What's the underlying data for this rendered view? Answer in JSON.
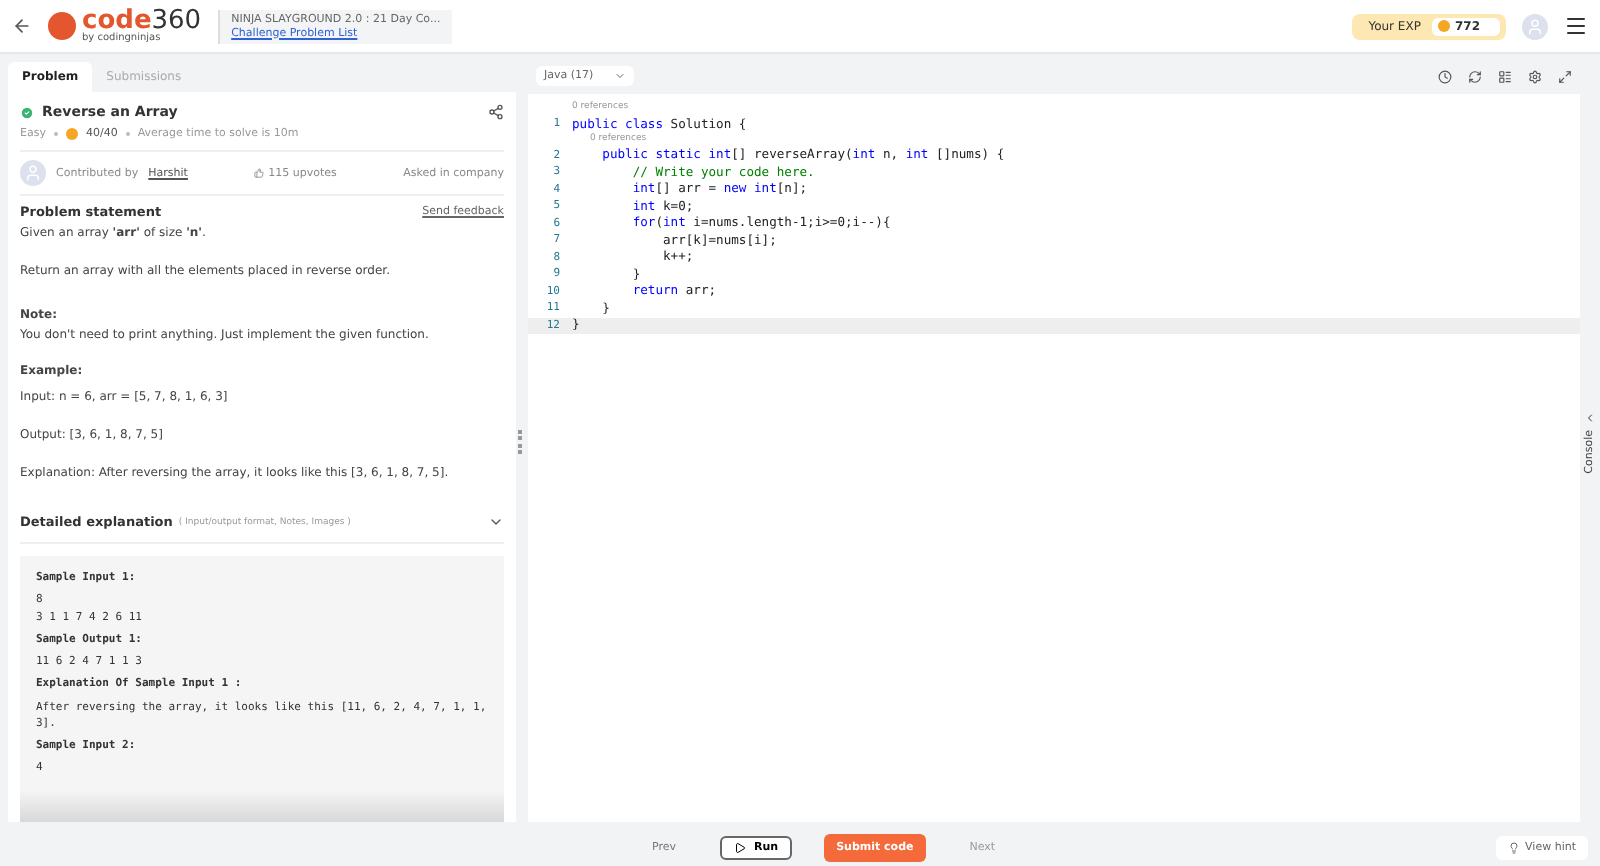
{
  "header": {
    "brand": "code",
    "brand_number": "360",
    "brand_sub": "by codingninjas",
    "contest": "NINJA SLAYGROUND 2.0 : 21 Day Co...",
    "contest_link": "Challenge Problem List",
    "exp_label": "Your EXP",
    "exp_value": "772"
  },
  "tabs": [
    {
      "label": "Problem",
      "selected": true
    },
    {
      "label": "Submissions",
      "selected": false
    }
  ],
  "problem": {
    "title": "Reverse an Array",
    "solved": true,
    "difficulty": "Easy",
    "score": "40/40",
    "avg_time": "Average time to solve is 10m",
    "contributed_by": "Contributed by",
    "author": "Harshit",
    "upvotes": "115 upvotes",
    "asked_in": "Asked in company",
    "statement_heading": "Problem statement",
    "feedback": "Send feedback",
    "paragraphs": [
      {
        "kind": "text",
        "text": "Given an array **'arr'** of size **'n'**."
      },
      {
        "kind": "text",
        "text": "Return an array with all the elements placed in reverse order."
      },
      {
        "kind": "heading",
        "text": "Note:"
      },
      {
        "kind": "tight",
        "text": "You don't need to print anything. Just implement the given function."
      },
      {
        "kind": "heading",
        "text": "Example:"
      },
      {
        "kind": "text",
        "text": "Input: n = 6, arr = [5, 7, 8, 1, 6, 3]"
      },
      {
        "kind": "text",
        "text": "Output: [3, 6, 1, 8, 7, 5]"
      },
      {
        "kind": "text",
        "text": "Explanation: After reversing the array, it looks like this [3, 6, 1, 8, 7, 5]."
      }
    ],
    "details_title": "Detailed explanation",
    "details_hint": "( Input/output format, Notes, Images )",
    "samples": [
      {
        "kind": "heading",
        "text": "Sample Input 1:"
      },
      {
        "kind": "data",
        "text": "8\n3 1 1 7 4 2 6 11"
      },
      {
        "kind": "heading",
        "text": "Sample Output 1:"
      },
      {
        "kind": "data",
        "text": "11 6 2 4 7 1 1 3"
      },
      {
        "kind": "heading",
        "text": "Explanation Of Sample Input 1 :"
      },
      {
        "kind": "data",
        "text": "After reversing the array, it looks like this [11, 6, 2, 4, 7, 1, 1, 3]."
      },
      {
        "kind": "heading",
        "text": "Sample Input 2:"
      },
      {
        "kind": "data",
        "text": "4"
      }
    ]
  },
  "editor": {
    "language": "Java (17)",
    "lines": [
      {
        "number": "1",
        "lens": "0 references",
        "tokens": [
          {
            "kind": "keyword",
            "text": "public class"
          },
          {
            "kind": "plain",
            "text": " Solution {"
          }
        ]
      },
      {
        "number": "2",
        "lens": "0 references",
        "tokens": [
          {
            "kind": "keyword",
            "text": "    public static int"
          },
          {
            "kind": "plain",
            "text": "[] reverseArray("
          },
          {
            "kind": "keyword",
            "text": "int"
          },
          {
            "kind": "plain",
            "text": " n, "
          },
          {
            "kind": "keyword",
            "text": "int"
          },
          {
            "kind": "plain",
            "text": " []nums) {"
          }
        ]
      },
      {
        "number": "3",
        "tokens": [
          {
            "kind": "comment",
            "text": "        // Write your code here."
          }
        ]
      },
      {
        "number": "4",
        "tokens": [
          {
            "kind": "keyword",
            "text": "        int"
          },
          {
            "kind": "plain",
            "text": "[] arr = "
          },
          {
            "kind": "keyword",
            "text": "new int"
          },
          {
            "kind": "plain",
            "text": "[n];"
          }
        ]
      },
      {
        "number": "5",
        "tokens": [
          {
            "kind": "keyword",
            "text": "        int"
          },
          {
            "kind": "plain",
            "text": " k=0;"
          }
        ]
      },
      {
        "number": "6",
        "tokens": [
          {
            "kind": "keyword",
            "text": "        for"
          },
          {
            "kind": "plain",
            "text": "("
          },
          {
            "kind": "keyword",
            "text": "int"
          },
          {
            "kind": "plain",
            "text": " i=nums.length-1;i>=0;i--){"
          }
        ]
      },
      {
        "number": "7",
        "tokens": [
          {
            "kind": "plain",
            "text": "            arr[k]=nums[i];"
          }
        ]
      },
      {
        "number": "8",
        "tokens": [
          {
            "kind": "plain",
            "text": "            k++;"
          }
        ]
      },
      {
        "number": "9",
        "tokens": [
          {
            "kind": "plain",
            "text": "        }"
          }
        ]
      },
      {
        "number": "10",
        "tokens": [
          {
            "kind": "keyword",
            "text": "        return"
          },
          {
            "kind": "plain",
            "text": " arr;"
          }
        ]
      },
      {
        "number": "11",
        "tokens": [
          {
            "kind": "plain",
            "text": "    }"
          }
        ]
      },
      {
        "number": "12",
        "current": true,
        "tokens": [
          {
            "kind": "plain",
            "text": "}"
          }
        ]
      }
    ],
    "console_label": "Console"
  },
  "footer": {
    "prev": "Prev",
    "run": "Run",
    "submit": "Submit code",
    "next": "Next",
    "hint": "View hint"
  }
}
